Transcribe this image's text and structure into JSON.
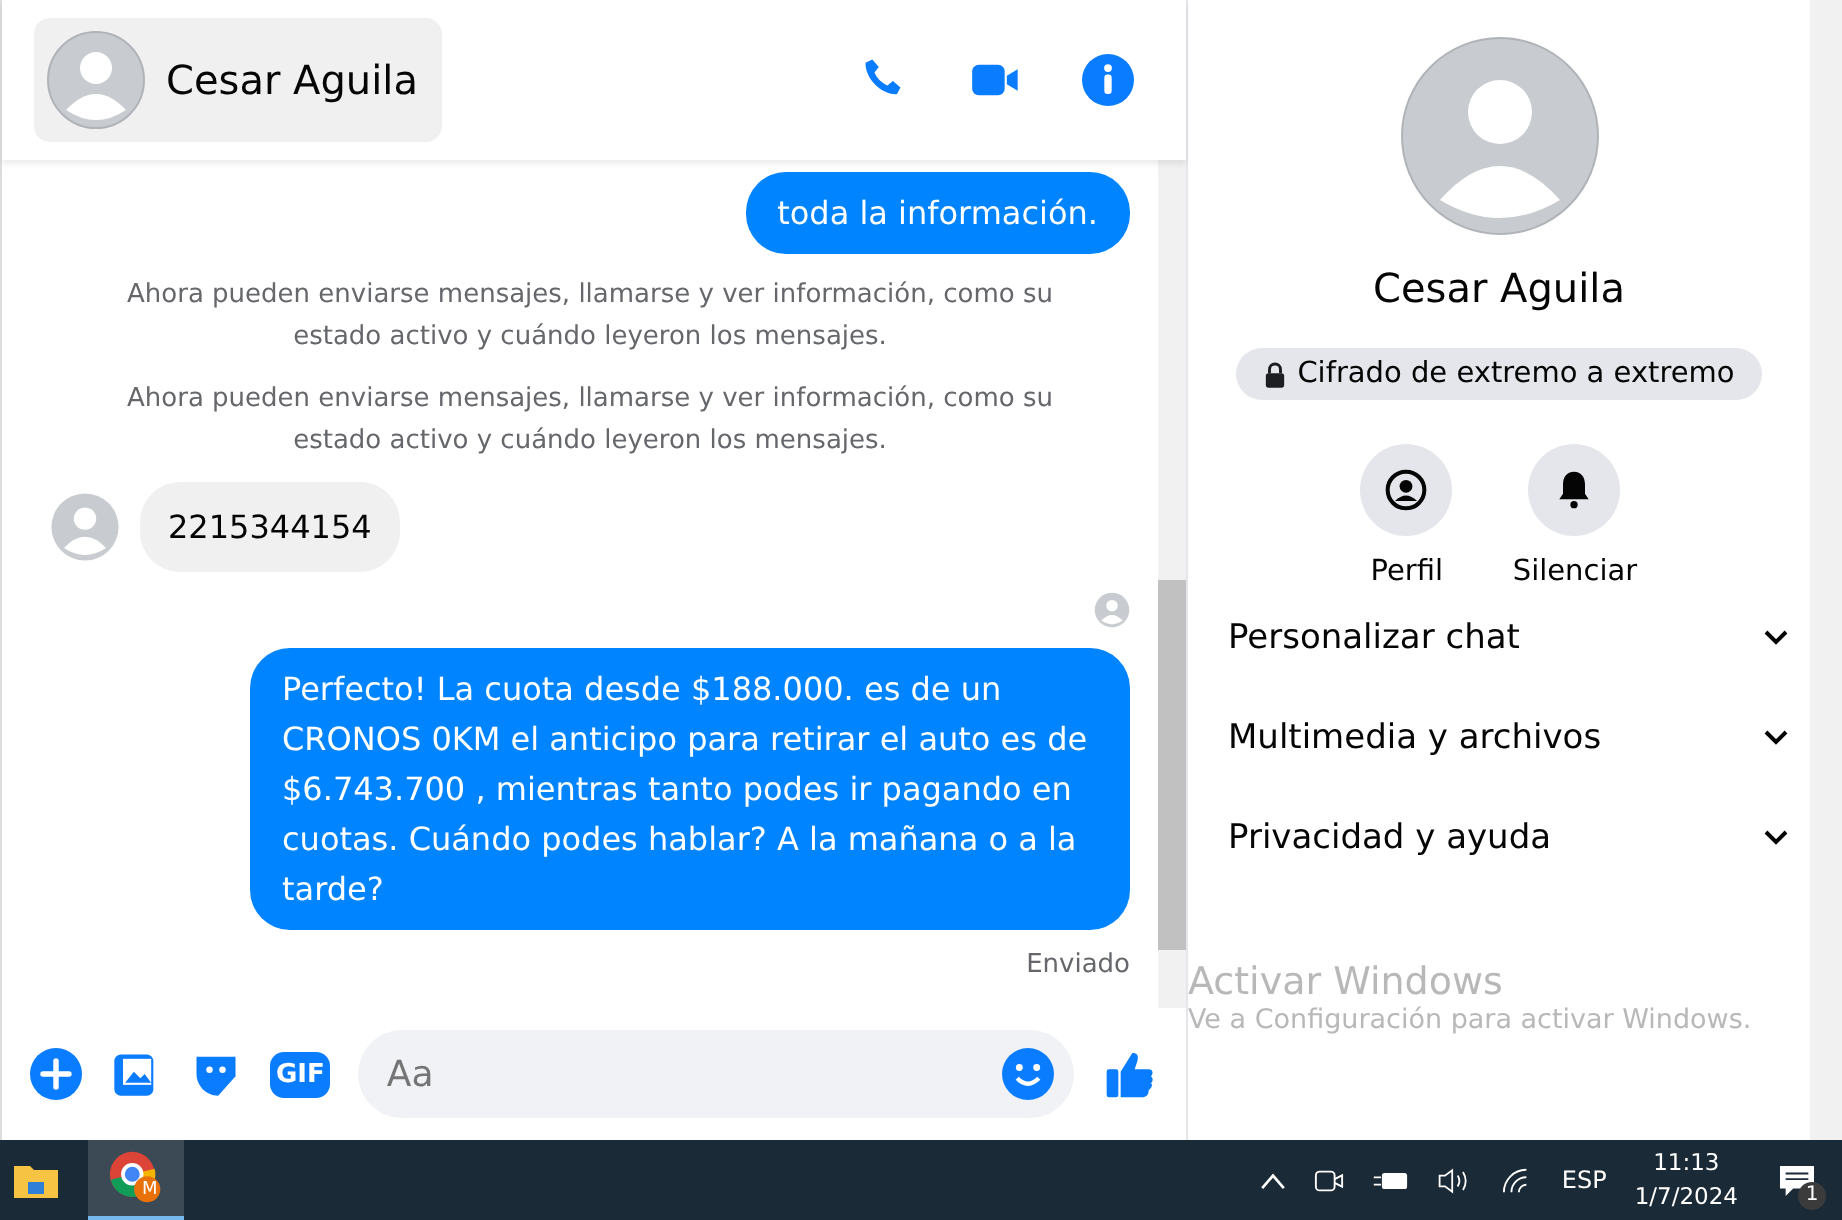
{
  "header": {
    "name": "Cesar Aguila"
  },
  "messages": [
    {
      "kind": "outgoing",
      "text": "toda la información."
    },
    {
      "kind": "system",
      "text": "Ahora pueden enviarse mensajes, llamarse y ver información, como su estado activo y cuándo leyeron los mensajes."
    },
    {
      "kind": "system",
      "text": "Ahora pueden enviarse mensajes, llamarse y ver información, como su estado activo y cuándo leyeron los mensajes."
    },
    {
      "kind": "incoming",
      "text": "2215344154"
    },
    {
      "kind": "seen"
    },
    {
      "kind": "outgoing",
      "text": "Perfecto! La cuota desde $188.000. es de un CRONOS 0KM el anticipo para retirar el auto es de $6.743.700 , mientras tanto podes ir pagando en cuotas. Cuándo podes hablar? A la mañana o a la tarde?"
    },
    {
      "kind": "status",
      "text": "Enviado"
    }
  ],
  "composer": {
    "placeholder": "Aa",
    "gif_label": "GIF"
  },
  "profile": {
    "name": "Cesar Aguila",
    "encryption": "Cifrado de extremo a extremo",
    "actions": [
      {
        "kind": "profile",
        "label": "Perfil"
      },
      {
        "kind": "mute",
        "label": "Silenciar"
      }
    ],
    "sections": [
      {
        "label": "Personalizar chat",
        "expanded": false
      },
      {
        "label": "Multimedia y archivos",
        "expanded": false
      },
      {
        "label": "Privacidad y ayuda",
        "expanded": false
      }
    ]
  },
  "activation": {
    "title": "Activar Windows",
    "subtitle": "Ve a Configuración para activar Windows."
  },
  "taskbar": {
    "language": "ESP",
    "time": "11:13",
    "date": "1/7/2024",
    "notifications": "1",
    "chrome_badge": "M"
  }
}
